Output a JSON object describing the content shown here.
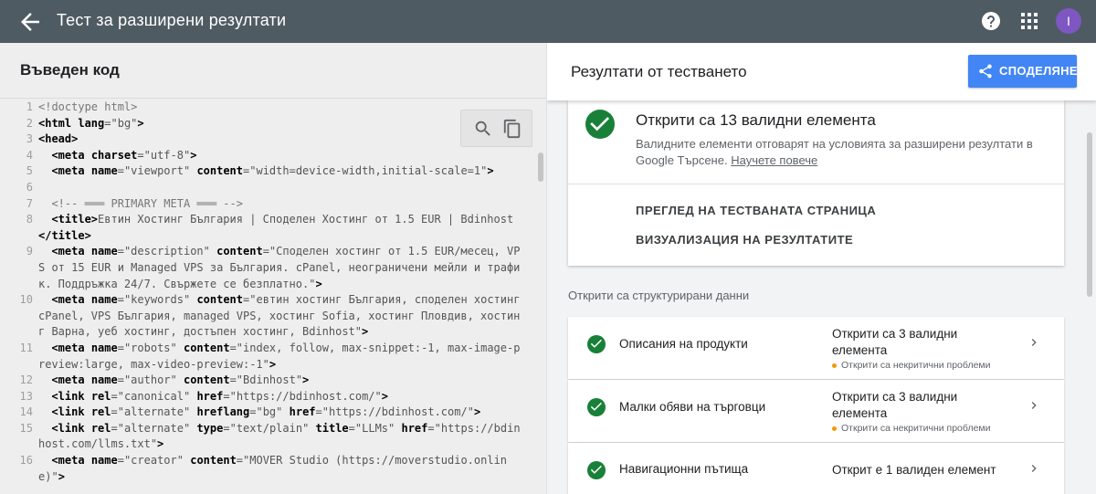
{
  "app": {
    "title": "Тест за разширени резултати",
    "avatar_letter": "I",
    "colors": {
      "topbar": "#4f5b62",
      "accent": "#4285f4",
      "success": "#188038",
      "warning": "#f29900",
      "avatar": "#7e57c2"
    }
  },
  "left": {
    "title": "Въведен код",
    "code_lines": [
      {
        "n": "1",
        "html": "<span class='cm'>&lt;!doctype html&gt;</span>"
      },
      {
        "n": "2",
        "html": "<span class='tg'>&lt;html</span> <span class='at'>lang</span>=<span class='vl'>\"bg\"</span><span class='tg'>&gt;</span>"
      },
      {
        "n": "3",
        "html": "<span class='tg'>&lt;head&gt;</span>"
      },
      {
        "n": "4",
        "html": "  <span class='tg'>&lt;meta</span> <span class='at'>charset</span>=<span class='vl'>\"utf-8\"</span><span class='tg'>&gt;</span>"
      },
      {
        "n": "5",
        "html": "  <span class='tg'>&lt;meta</span> <span class='at'>name</span>=<span class='vl'>\"viewport\"</span> <span class='at'>content</span>=<span class='vl'>\"width=device-width,initial-scale=1\"</span><span class='tg'>&gt;</span>"
      },
      {
        "n": "6",
        "html": ""
      },
      {
        "n": "7",
        "html": "  <span class='cm'>&lt;!-- ═══ PRIMARY META ═══ --&gt;</span>"
      },
      {
        "n": "8",
        "html": "  <span class='tg'>&lt;title&gt;</span>Евтин Хостинг България | Споделен Хостинг от 1.5 EUR | Bdinhost<span class='tg'>&lt;/title&gt;</span>"
      },
      {
        "n": "9",
        "html": "  <span class='tg'>&lt;meta</span> <span class='at'>name</span>=<span class='vl'>\"description\"</span> <span class='at'>content</span>=<span class='vl'>\"Споделен хостинг от 1.5 EUR/месец, VPS от 15 EUR и Managed VPS за България. cPanel, неограничени мейли и трафик. Поддръжка 24/7. Свържете се безплатно.\"</span><span class='tg'>&gt;</span>"
      },
      {
        "n": "10",
        "html": "  <span class='tg'>&lt;meta</span> <span class='at'>name</span>=<span class='vl'>\"keywords\"</span> <span class='at'>content</span>=<span class='vl'>\"евтин хостинг България, споделен хостинг cPanel, VPS България, managed VPS, хостинг Sofia, хостинг Пловдив, хостинг Варна, уеб хостинг, достъпен хостинг, Bdinhost\"</span><span class='tg'>&gt;</span>"
      },
      {
        "n": "11",
        "html": "  <span class='tg'>&lt;meta</span> <span class='at'>name</span>=<span class='vl'>\"robots\"</span> <span class='at'>content</span>=<span class='vl'>\"index, follow, max-snippet:-1, max-image-preview:large, max-video-preview:-1\"</span><span class='tg'>&gt;</span>"
      },
      {
        "n": "12",
        "html": "  <span class='tg'>&lt;meta</span> <span class='at'>name</span>=<span class='vl'>\"author\"</span> <span class='at'>content</span>=<span class='vl'>\"Bdinhost\"</span><span class='tg'>&gt;</span>"
      },
      {
        "n": "13",
        "html": "  <span class='tg'>&lt;link</span> <span class='at'>rel</span>=<span class='vl'>\"canonical\"</span> <span class='at'>href</span>=<span class='vl'>\"https://bdinhost.com/\"</span><span class='tg'>&gt;</span>"
      },
      {
        "n": "14",
        "html": "  <span class='tg'>&lt;link</span> <span class='at'>rel</span>=<span class='vl'>\"alternate\"</span> <span class='at'>hreflang</span>=<span class='vl'>\"bg\"</span> <span class='at'>href</span>=<span class='vl'>\"https://bdinhost.com/\"</span><span class='tg'>&gt;</span>"
      },
      {
        "n": "15",
        "html": "  <span class='tg'>&lt;link</span> <span class='at'>rel</span>=<span class='vl'>\"alternate\"</span> <span class='at'>type</span>=<span class='vl'>\"text/plain\"</span> <span class='at'>title</span>=<span class='vl'>\"LLMs\"</span> <span class='at'>href</span>=<span class='vl'>\"https://bdinhost.com/llms.txt\"</span><span class='tg'>&gt;</span>"
      },
      {
        "n": "16",
        "html": "  <span class='tg'>&lt;meta</span> <span class='at'>name</span>=<span class='vl'>\"creator\"</span> <span class='at'>content</span>=<span class='vl'>\"MOVER Studio (https://moverstudio.online)\"</span><span class='tg'>&gt;</span>"
      }
    ]
  },
  "right": {
    "title": "Резултати от тестването",
    "share_label": "СПОДЕЛЯНЕ",
    "summary": {
      "title": "Открити са 13 валидни елемента",
      "desc": "Валидните елементи отговарят на условията за разширени резултати в Google Търсене.",
      "learn_more": "Научете повече",
      "link_preview": "ПРЕГЛЕД НА ТЕСТВАНАТА СТРАНИЦА",
      "link_visualize": "ВИЗУАЛИЗАЦИЯ НА РЕЗУЛТАТИТЕ"
    },
    "section_label": "Открити са структурирани данни",
    "rows": [
      {
        "name": "Описания на продукти",
        "status": "Открити са 3 валидни елемента",
        "warning": "Открити са некритични проблеми"
      },
      {
        "name": "Малки обяви на търговци",
        "status": "Открити са 3 валидни елемента",
        "warning": "Открити са некритични проблеми"
      },
      {
        "name": "Навигационни пътища",
        "status": "Открит е 1 валиден елемент",
        "warning": ""
      }
    ]
  }
}
